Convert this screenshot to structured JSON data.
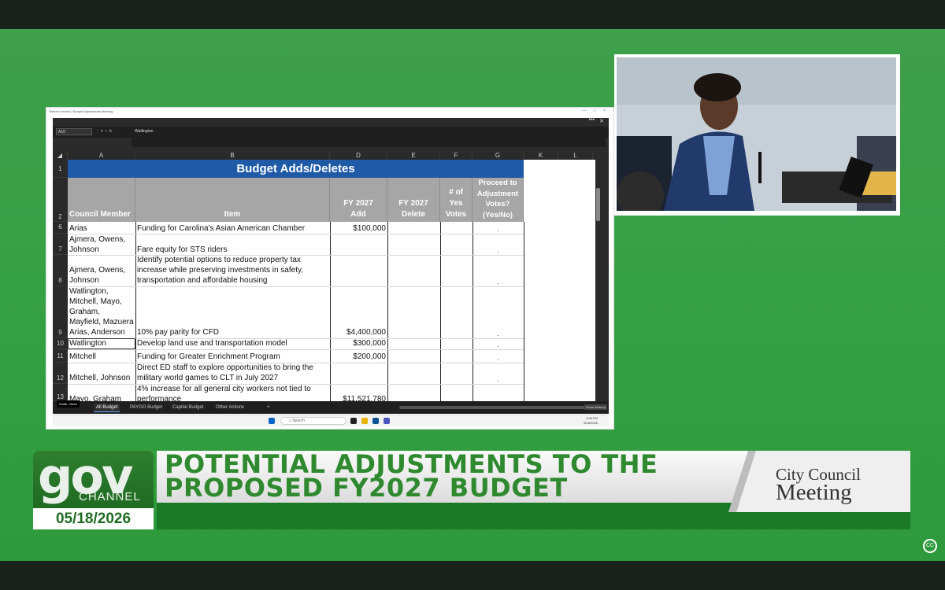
{
  "window": {
    "title": "Shared content | Budget Adjustments Meeting",
    "controls": "— □ ×"
  },
  "excel": {
    "name_box": "A10",
    "formula": "Watlington",
    "fx_label": "fx",
    "columns": [
      "A",
      "B",
      "D",
      "E",
      "F",
      "G",
      "K",
      "L"
    ],
    "title": "Budget Adds/Deletes",
    "headers": {
      "member": "Council Member",
      "item": "Item",
      "add": "FY 2027\nAdd",
      "delete": "FY 2027\nDelete",
      "yes": "# of\nYes\nVotes",
      "proceed": "Proceed to\nAdjustment\nVotes?\n(Yes/No)"
    },
    "row_numbers": [
      "1",
      "2",
      "6",
      "7",
      "8",
      "9",
      "10",
      "11",
      "12",
      "13"
    ],
    "rows": [
      {
        "num": "6",
        "member": "Arias",
        "item": "Funding for Carolina's Asian American Chamber",
        "add": "$100,000"
      },
      {
        "num": "7",
        "member": "Ajmera, Owens,\nJohnson",
        "item": "Fare equity for STS riders",
        "add": ""
      },
      {
        "num": "8",
        "member": "Ajmera, Owens,\nJohnson",
        "item": "Identify potential options to reduce property tax\nincrease while preserving investments in safety,\ntransportation and affordable housing",
        "add": ""
      },
      {
        "num": "9",
        "member": "Watlington,\nMitchell, Mayo,\nGraham,\nMayfield, Mazuera\nArias, Anderson",
        "item": "10% pay parity for CFD",
        "add": "$4,400,000"
      },
      {
        "num": "10",
        "member": "Watlington",
        "item": "Develop land use and transportation model",
        "add": "$300,000"
      },
      {
        "num": "11",
        "member": "Mitchell",
        "item": "Funding for Greater Enrichment Program",
        "add": "$200,000"
      },
      {
        "num": "12",
        "member": "Mitchell, Johnson",
        "item": "Direct ED staff to explore opportunities to bring the\nmilitary world games to CLT in July 2027",
        "add": ""
      },
      {
        "num": "13",
        "member": "Mayo, Graham",
        "item": "4% increase for all general city workers not tied to\nperformance",
        "add": "$11,521,780"
      }
    ],
    "sheet_tabs": [
      "All Budget",
      "PAYGO Budget",
      "Capital Budget",
      "Other Actions",
      "+"
    ],
    "user_chip": "Smith, Owen",
    "show_desktop": "Show desktop"
  },
  "taskbar": {
    "search": "Search",
    "time": "3:08 PM",
    "date": "5/18/2026"
  },
  "lower_third": {
    "logo_big": "gov",
    "logo_channel": "CHANNEL",
    "date": "05/18/2026",
    "title_line1": "POTENTIAL ADJUSTMENTS TO THE",
    "title_line2": "PROPOSED FY2027 BUDGET",
    "meeting_line1": "City Council",
    "meeting_line2": "Meeting"
  },
  "colors": {
    "background": "#35a043",
    "title_fill": "#1f5aa6",
    "header_fill": "#a6a6a6",
    "brand_green": "#1a7a26"
  },
  "icons": [
    "windows-icon",
    "search-icon",
    "file-explorer-icon",
    "mail-icon",
    "teams-icon",
    "closed-caption-icon"
  ]
}
